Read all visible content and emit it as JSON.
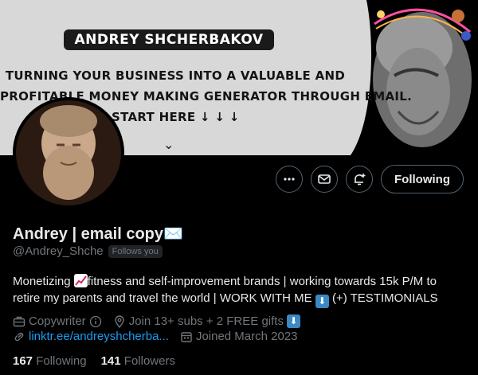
{
  "banner": {
    "name": "ANDREY SHCHERBAKOV",
    "line1": "TURNING YOUR BUSINESS INTO A VALUABLE AND",
    "line2": "PROFITABLE MONEY MAKING GENERATOR THROUGH EMAIL.",
    "line3": "START HERE ↓ ↓ ↓",
    "chevron": "⌄"
  },
  "actions": {
    "more_icon": "more-icon",
    "message_icon": "mail-icon",
    "notify_icon": "bell-plus-icon",
    "follow_label": "Following"
  },
  "profile": {
    "display_name": "Andrey | email copy",
    "display_emoji": "✉️",
    "handle": "@Andrey_Shche",
    "follows_you": "Follows you",
    "bio_part1": "Monetizing ",
    "bio_part2": "fitness and self-improvement brands | working towards 15k P/M to retire my parents and travel the world | WORK WITH ME ",
    "bio_part3": " (+) TESTIMONIALS",
    "category": "Copywriter",
    "location": "Join 13+ subs + 2 FREE gifts",
    "link": "linktr.ee/andreyshcherba...",
    "joined": "Joined March 2023"
  },
  "stats": {
    "following_count": "167",
    "following_label": "Following",
    "followers_count": "141",
    "followers_label": "Followers"
  },
  "colors": {
    "background": "#000000",
    "accent": "#1d9bf0",
    "muted": "#71767b",
    "text": "#e7e9ea"
  }
}
